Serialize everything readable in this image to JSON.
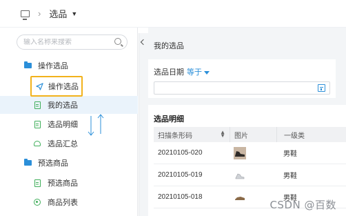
{
  "topbar": {
    "title": "选品"
  },
  "sidebar": {
    "search_placeholder": "输入名称来搜索",
    "items": [
      {
        "label": "操作选品",
        "kind": "group",
        "icon": "folder-icon"
      },
      {
        "label": "操作选品",
        "kind": "sub",
        "icon": "send-icon",
        "highlighted": true
      },
      {
        "label": "我的选品",
        "kind": "sub",
        "icon": "document-icon",
        "active": true
      },
      {
        "label": "选品明细",
        "kind": "sub",
        "icon": "document-icon"
      },
      {
        "label": "选品汇总",
        "kind": "sub",
        "icon": "cloud-icon"
      },
      {
        "label": "预选商品",
        "kind": "group",
        "icon": "folder-icon"
      },
      {
        "label": "预选商品",
        "kind": "sub",
        "icon": "document-icon"
      },
      {
        "label": "商品列表",
        "kind": "sub",
        "icon": "ring-icon"
      }
    ]
  },
  "main": {
    "panel_title": "我的选品",
    "filter": {
      "label": "选品日期",
      "operator": "等于",
      "value": ""
    },
    "detail": {
      "title": "选品明细",
      "columns": [
        "扫描条形码",
        "图片",
        "一级类"
      ],
      "rows": [
        {
          "barcode": "20210105-020",
          "image": "dark-shoe",
          "category": "男鞋"
        },
        {
          "barcode": "20210105-019",
          "image": "light-shoe",
          "category": "男鞋"
        },
        {
          "barcode": "20210105-018",
          "image": "brown-shoe",
          "category": "男鞋"
        }
      ]
    }
  },
  "watermark": "CSDN @百数",
  "colors": {
    "accent": "#2b8fd9",
    "highlight_border": "#f2b21b",
    "icon_green": "#3fae5a",
    "active_bg": "#eaf3fb"
  }
}
